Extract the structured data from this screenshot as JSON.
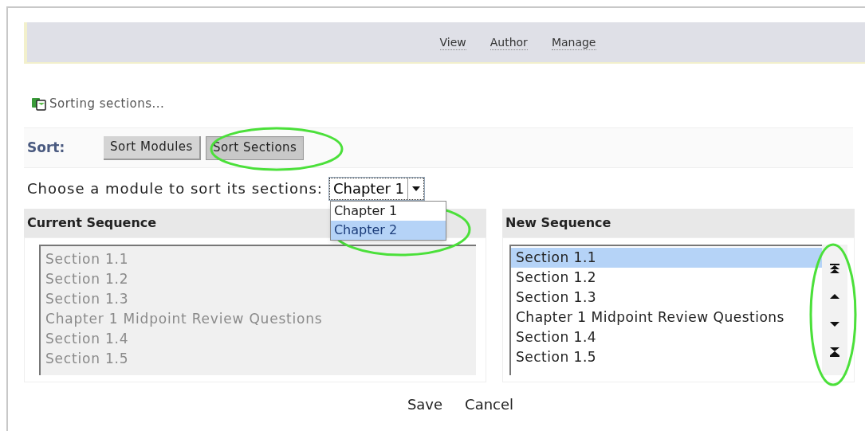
{
  "nav": [
    {
      "label": "View"
    },
    {
      "label": "Author"
    },
    {
      "label": "Manage"
    }
  ],
  "status": {
    "text": "Sorting sections..."
  },
  "sort": {
    "label": "Sort:",
    "buttons": [
      {
        "label": "Sort Modules",
        "selected": false
      },
      {
        "label": "Sort Sections",
        "selected": true
      }
    ]
  },
  "module_picker": {
    "label": "Choose a module to sort its sections:",
    "value": "Chapter 1",
    "expanded": true,
    "options": [
      {
        "label": "Chapter 1",
        "highlighted": false
      },
      {
        "label": "Chapter 2",
        "highlighted": true
      }
    ]
  },
  "current_sequence": {
    "title": "Current Sequence",
    "disabled": true,
    "items": [
      {
        "label": "Section 1.1"
      },
      {
        "label": "Section 1.2"
      },
      {
        "label": "Section 1.3"
      },
      {
        "label": "Chapter 1 Midpoint Review Questions"
      },
      {
        "label": "Section 1.4"
      },
      {
        "label": "Section 1.5"
      }
    ]
  },
  "new_sequence": {
    "title": "New Sequence",
    "items": [
      {
        "label": "Section 1.1",
        "selected": true
      },
      {
        "label": "Section 1.2",
        "selected": false
      },
      {
        "label": "Section 1.3",
        "selected": false
      },
      {
        "label": "Chapter 1 Midpoint Review Questions",
        "selected": false
      },
      {
        "label": "Section 1.4",
        "selected": false
      },
      {
        "label": "Section 1.5",
        "selected": false
      }
    ],
    "move_buttons": [
      {
        "kind": "top"
      },
      {
        "kind": "up"
      },
      {
        "kind": "down"
      },
      {
        "kind": "bottom"
      }
    ]
  },
  "actions": [
    {
      "label": "Save"
    },
    {
      "label": "Cancel"
    }
  ]
}
